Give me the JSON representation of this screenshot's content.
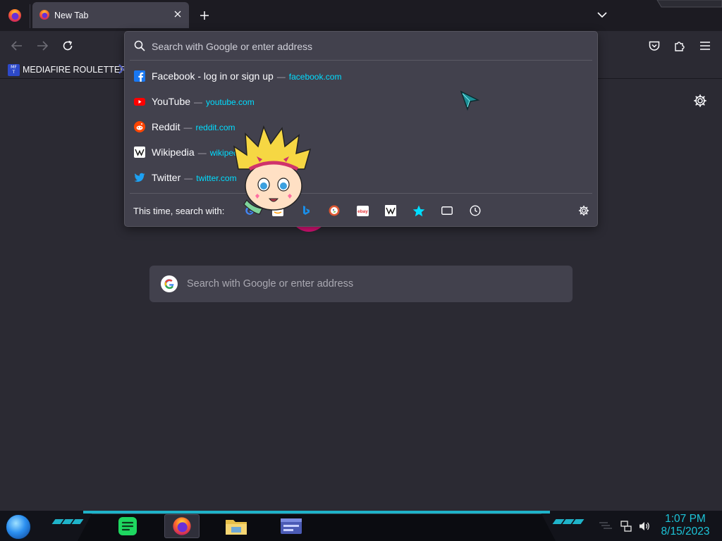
{
  "browser": {
    "tab": {
      "title": "New Tab"
    }
  },
  "bookmarks": [
    {
      "label": "MEDIAFIRE ROULETTER",
      "icon": "mediafire-icon",
      "icon_text_top": "MF",
      "icon_text_bottom": "T"
    }
  ],
  "urlbar": {
    "placeholder": "Search with Google or enter address",
    "results": [
      {
        "title": "Facebook - log in or sign up",
        "separator": "—",
        "url": "facebook.com",
        "icon": "facebook-icon"
      },
      {
        "title": "YouTube",
        "separator": "—",
        "url": "youtube.com",
        "icon": "youtube-icon"
      },
      {
        "title": "Reddit",
        "separator": "—",
        "url": "reddit.com",
        "icon": "reddit-icon"
      },
      {
        "title": "Wikipedia",
        "separator": "—",
        "url": "wikiped",
        "icon": "wikipedia-icon"
      },
      {
        "title": "Twitter",
        "separator": "—",
        "url": "twitter.com",
        "icon": "twitter-icon"
      }
    ],
    "oneoff_label": "This time, search with:",
    "oneoff_engines": [
      "google-icon",
      "bing-icon",
      "duckduckgo-icon",
      "ebay-icon",
      "wikipedia-icon",
      "bookmarks-star-icon",
      "tabs-icon",
      "history-icon"
    ],
    "ebay_text": "ebay"
  },
  "page": {
    "search_placeholder": "Search with Google or enter address"
  },
  "taskbar": {
    "time": "1:07 PM",
    "date": "8/15/2023"
  },
  "colors": {
    "accent_cyan": "#00ddff",
    "taskbar_cyan": "#1fb3c9",
    "clock_cyan": "#1cc4d8",
    "panel": "#42414d",
    "background": "#2b2a33"
  }
}
